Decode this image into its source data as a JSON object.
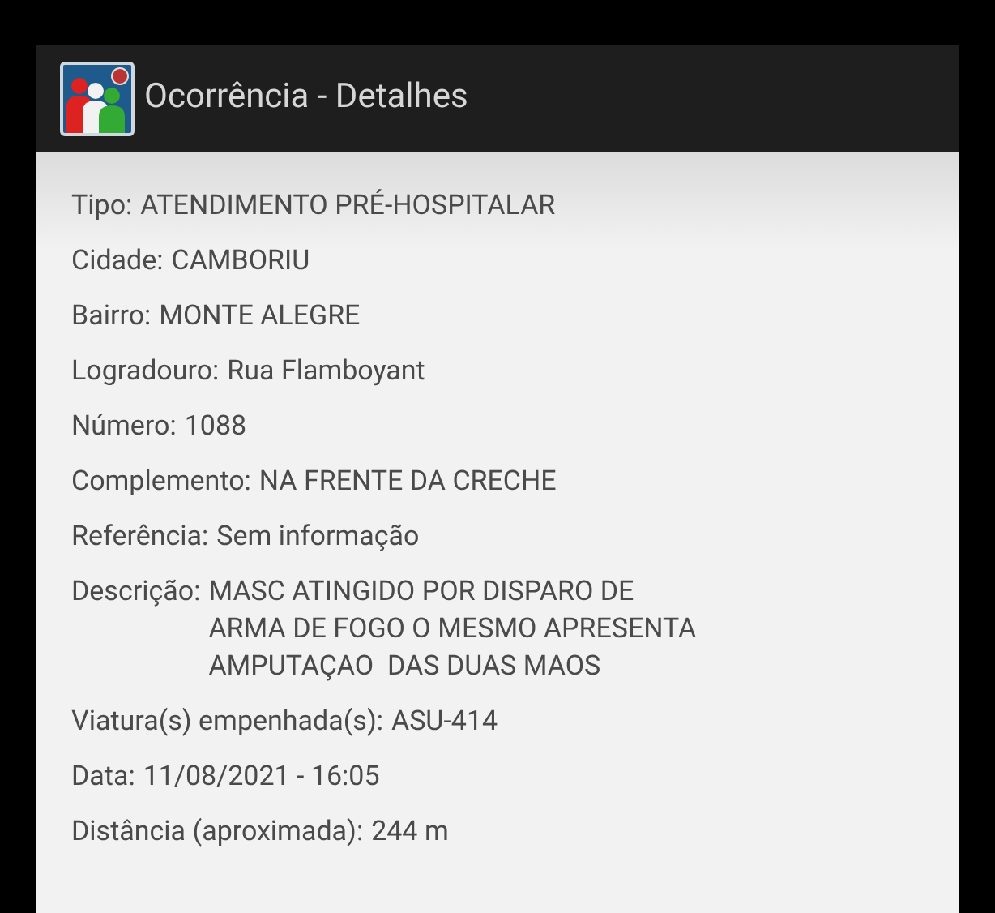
{
  "app_bar": {
    "title": "Ocorrência - Detalhes"
  },
  "details": [
    {
      "label": "Tipo:",
      "value_lines": [
        "ATENDIMENTO PRÉ-HOSPITALAR"
      ]
    },
    {
      "label": "Cidade:",
      "value_lines": [
        "CAMBORIU"
      ]
    },
    {
      "label": "Bairro:",
      "value_lines": [
        "MONTE ALEGRE"
      ]
    },
    {
      "label": "Logradouro:",
      "value_lines": [
        "Rua Flamboyant"
      ]
    },
    {
      "label": "Número:",
      "value_lines": [
        "1088"
      ]
    },
    {
      "label": "Complemento:",
      "value_lines": [
        "NA FRENTE DA CRECHE"
      ]
    },
    {
      "label": "Referência:",
      "value_lines": [
        "Sem informação"
      ]
    },
    {
      "label": "Descrição:",
      "value_lines": [
        "MASC ATINGIDO POR DISPARO DE",
        "ARMA DE FOGO O MESMO APRESENTA",
        "AMPUTAÇAO  DAS DUAS MAOS"
      ]
    },
    {
      "label": "Viatura(s) empenhada(s):",
      "value_lines": [
        "ASU-414"
      ]
    },
    {
      "label": "Data:",
      "value_lines": [
        "11/08/2021 - 16:05"
      ]
    },
    {
      "label": "Distância (aproximada):",
      "value_lines": [
        "244 m"
      ]
    }
  ]
}
